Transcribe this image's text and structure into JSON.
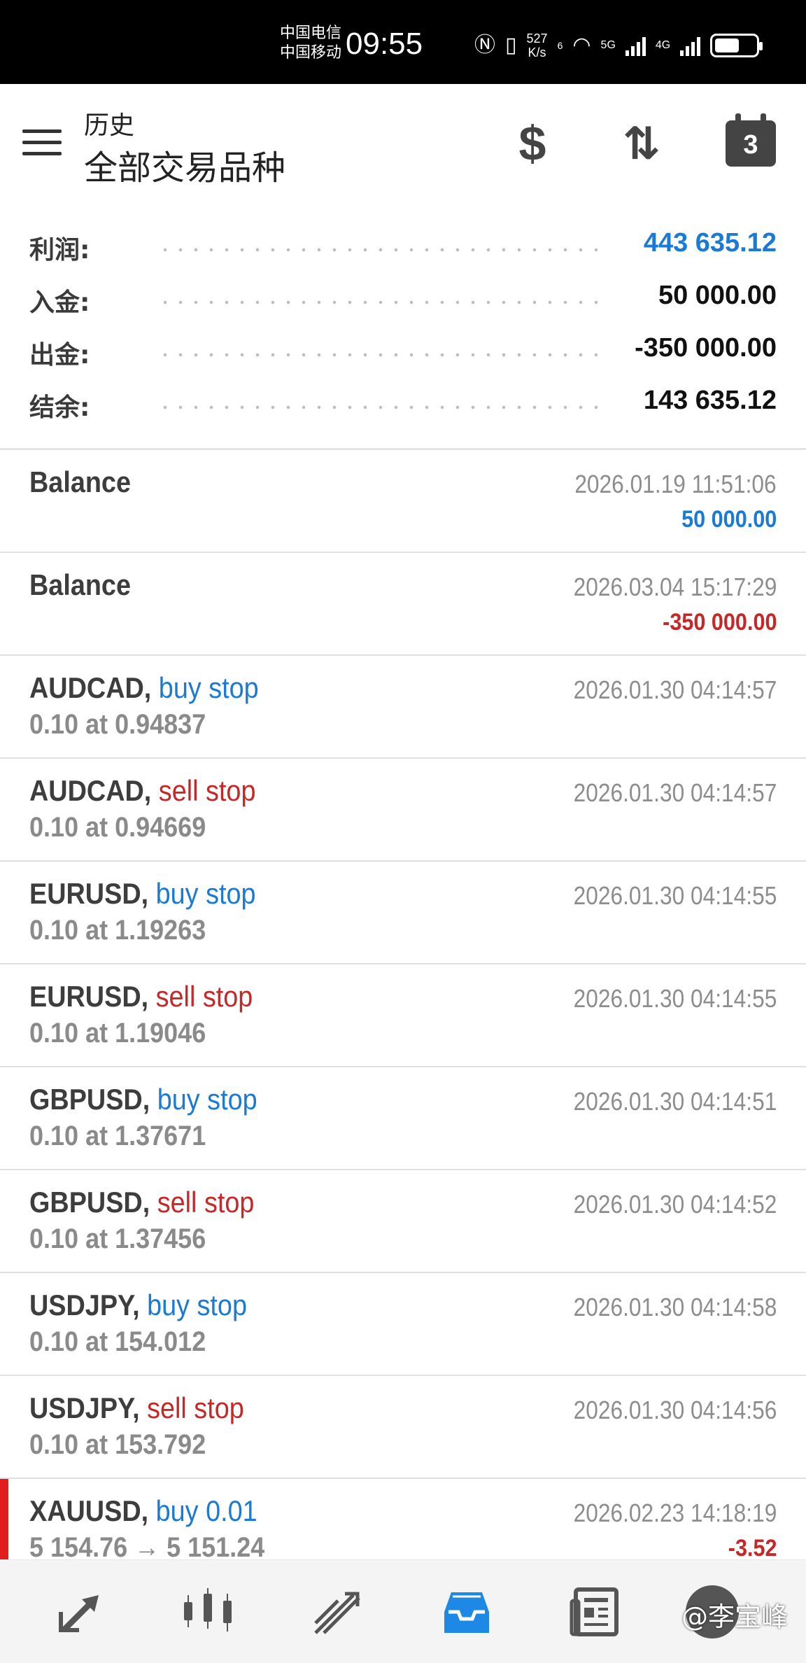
{
  "status_bar": {
    "carrier1": "中国电信",
    "carrier2": "中国移动",
    "time": "09:55",
    "speed_value": "527",
    "speed_unit": "K/s",
    "net1": "5G",
    "net2": "4G",
    "wifi_sup": "6"
  },
  "header": {
    "subtitle": "历史",
    "title": "全部交易品种",
    "calendar_badge": "3"
  },
  "summary": [
    {
      "label": "利润:",
      "value": "443 635.12",
      "color": "#1b7ad3"
    },
    {
      "label": "入金:",
      "value": "50 000.00",
      "color": "#111111"
    },
    {
      "label": "出金:",
      "value": "-350 000.00",
      "color": "#111111"
    },
    {
      "label": "结余:",
      "value": "143 635.12",
      "color": "#111111"
    }
  ],
  "history": [
    {
      "symbol": "Balance",
      "type": "",
      "detail": "",
      "time": "2026.01.19 11:51:06",
      "amount": "50 000.00",
      "amount_color": "blue"
    },
    {
      "symbol": "Balance",
      "type": "",
      "detail": "",
      "time": "2026.03.04 15:17:29",
      "amount": "-350 000.00",
      "amount_color": "red"
    },
    {
      "symbol": "AUDCAD,",
      "type": "buy stop",
      "type_color": "blue",
      "detail": "0.10 at 0.94837",
      "time": "2026.01.30 04:14:57",
      "amount": ""
    },
    {
      "symbol": "AUDCAD,",
      "type": "sell stop",
      "type_color": "red",
      "detail": "0.10 at 0.94669",
      "time": "2026.01.30 04:14:57",
      "amount": ""
    },
    {
      "symbol": "EURUSD,",
      "type": "buy stop",
      "type_color": "blue",
      "detail": "0.10 at 1.19263",
      "time": "2026.01.30 04:14:55",
      "amount": ""
    },
    {
      "symbol": "EURUSD,",
      "type": "sell stop",
      "type_color": "red",
      "detail": "0.10 at 1.19046",
      "time": "2026.01.30 04:14:55",
      "amount": ""
    },
    {
      "symbol": "GBPUSD,",
      "type": "buy stop",
      "type_color": "blue",
      "detail": "0.10 at 1.37671",
      "time": "2026.01.30 04:14:51",
      "amount": ""
    },
    {
      "symbol": "GBPUSD,",
      "type": "sell stop",
      "type_color": "red",
      "detail": "0.10 at 1.37456",
      "time": "2026.01.30 04:14:52",
      "amount": ""
    },
    {
      "symbol": "USDJPY,",
      "type": "buy stop",
      "type_color": "blue",
      "detail": "0.10 at 154.012",
      "time": "2026.01.30 04:14:58",
      "amount": ""
    },
    {
      "symbol": "USDJPY,",
      "type": "sell stop",
      "type_color": "red",
      "detail": "0.10 at 153.792",
      "time": "2026.01.30 04:14:56",
      "amount": ""
    },
    {
      "symbol": "XAUUSD,",
      "type": "buy 0.01",
      "type_color": "blue",
      "detail": "5 154.76 → 5 151.24",
      "time": "2026.02.23 14:18:19",
      "amount": "-3.52",
      "amount_color": "red"
    }
  ],
  "bottom_nav": [
    {
      "name": "quotes-icon"
    },
    {
      "name": "chart-icon"
    },
    {
      "name": "trade-icon"
    },
    {
      "name": "history-icon",
      "active": true
    },
    {
      "name": "news-icon"
    }
  ],
  "watermark": "@李宝峰"
}
